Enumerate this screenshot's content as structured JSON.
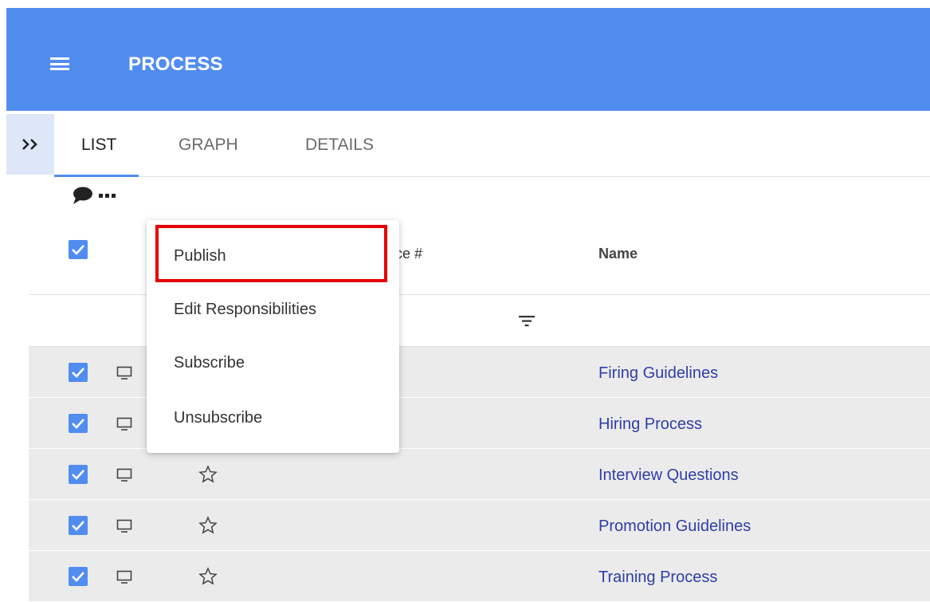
{
  "header": {
    "title": "PROCESS"
  },
  "tabs": [
    {
      "label": "LIST",
      "active": true
    },
    {
      "label": "GRAPH"
    },
    {
      "label": "DETAILS"
    }
  ],
  "table": {
    "columns": {
      "number_partial": "ce #",
      "name": "Name"
    },
    "rows": [
      {
        "name": "Firing Guidelines",
        "checked": true
      },
      {
        "name": "Hiring Process",
        "checked": true
      },
      {
        "name": "Interview Questions",
        "checked": true
      },
      {
        "name": "Promotion Guidelines",
        "checked": true
      },
      {
        "name": "Training Process",
        "checked": true
      }
    ]
  },
  "menu": {
    "items": [
      {
        "label": "Publish",
        "highlighted": true
      },
      {
        "label": "Edit Responsibilities"
      },
      {
        "label": "Subscribe"
      },
      {
        "label": "Unsubscribe"
      }
    ]
  },
  "colors": {
    "header_bg": "#518def",
    "link": "#2f3ea8",
    "highlight_border": "#e60000",
    "row_bg": "#ebebeb"
  },
  "icons": [
    "menu-icon",
    "expand-icon",
    "comment-icon",
    "more-icon",
    "filter-icon",
    "monitor-icon",
    "star-icon",
    "checkmark-icon"
  ]
}
